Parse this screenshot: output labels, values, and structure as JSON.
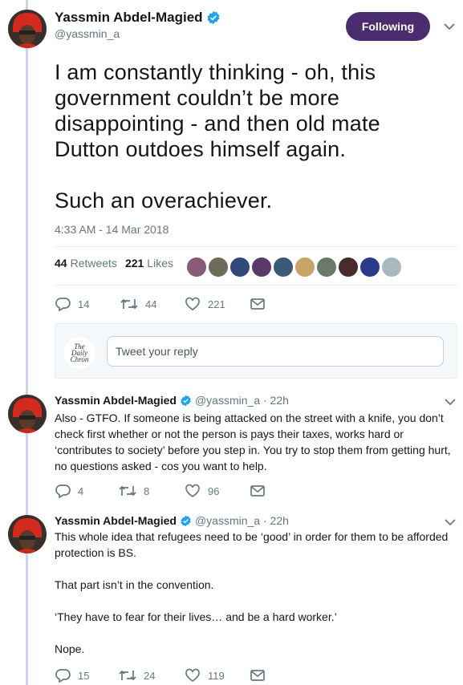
{
  "main_tweet": {
    "author_name": "Yassmin Abdel-Magied",
    "handle": "@yassmin_a",
    "follow_label": "Following",
    "text": "I am constantly thinking - oh, this government couldn’t be more disappointing - and then old mate Dutton outdoes himself again.\n\nSuch an overachiever.",
    "timestamp": "4:33 AM - 14 Mar 2018",
    "retweets_count": "44",
    "retweets_label": "Retweets",
    "likes_count": "221",
    "likes_label": "Likes",
    "actions": {
      "replies": "14",
      "retweets": "44",
      "likes": "221"
    }
  },
  "reply_box": {
    "avatar_text": "The Daily Chronicle",
    "placeholder": "Tweet your reply"
  },
  "replies": [
    {
      "author_name": "Yassmin Abdel-Magied",
      "meta": "@yassmin_a · 22h",
      "text": "Also - GTFO. If someone is being attacked on the street with a knife, you don’t check first whether or not the person is pays their taxes, works hard or ‘contributes to society’ before you step in. You try to stop them from getting hurt, no questions asked - cos you want to help.",
      "actions": {
        "replies": "4",
        "retweets": "8",
        "likes": "96"
      }
    },
    {
      "author_name": "Yassmin Abdel-Magied",
      "meta": "@yassmin_a · 22h",
      "text": "This whole idea that refugees need to be ‘good’ in order for them to be afforded protection is BS.\n\nThat part isn’t in the convention.\n\n‘They have to fear for their lives… and be a hard worker.’\n\nNope.",
      "actions": {
        "replies": "15",
        "retweets": "24",
        "likes": "119"
      }
    }
  ],
  "colors": {
    "accent": "#4b2c6e",
    "verified": "#1da1f2",
    "muted": "#657786",
    "thread_line": "#cdd3e8"
  }
}
